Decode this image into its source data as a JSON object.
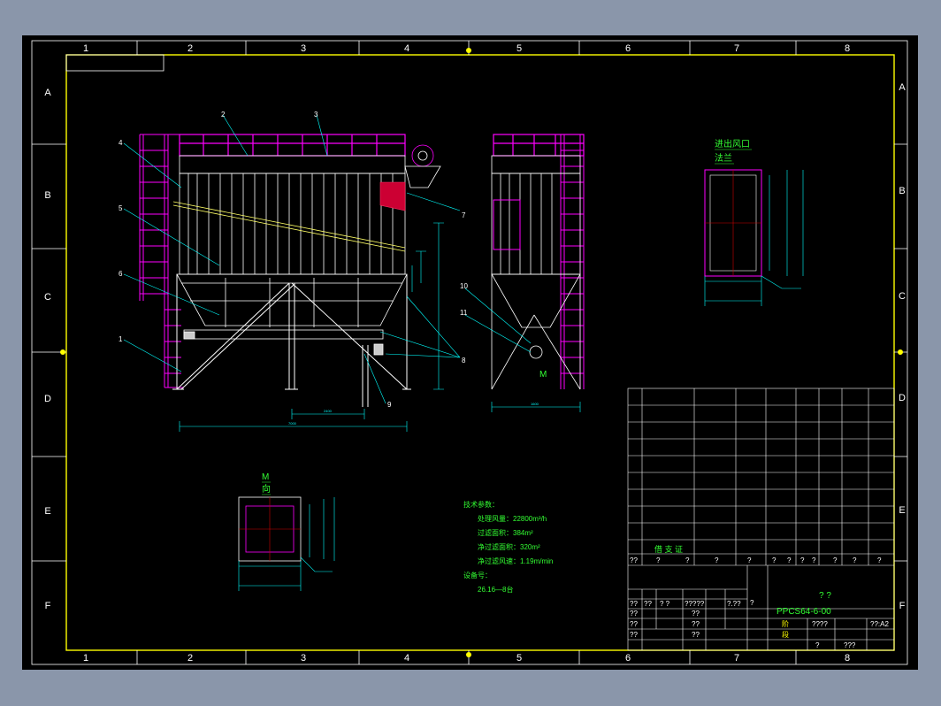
{
  "zones": {
    "columns": [
      "1",
      "2",
      "3",
      "4",
      "5",
      "6",
      "7",
      "8"
    ],
    "rows": [
      "A",
      "B",
      "C",
      "D",
      "E",
      "F"
    ]
  },
  "callouts_main": [
    "1",
    "2",
    "3",
    "4",
    "5",
    "6",
    "7",
    "8",
    "9",
    "10"
  ],
  "callouts_side": [
    "10",
    "11"
  ],
  "view_marker_label": "M",
  "view_m": {
    "title": "M",
    "subtitle": "向"
  },
  "flange": {
    "title": "进出风口",
    "subtitle": "法兰"
  },
  "tech_params": {
    "heading": "技术参数：",
    "lines": [
      "处理风量：22800m³/h",
      "过滤面积：384m²",
      "净过滤面积：320m²",
      "净过滤风速：1.19m/min"
    ],
    "equip_heading": "设备号：",
    "equip_line": "26.16—8台"
  },
  "title_block": {
    "signature_label": "借 支 证",
    "question_row": [
      "??",
      "?",
      "?",
      "?",
      "?",
      "?",
      "?",
      "?",
      "?",
      "?",
      "?",
      "?"
    ],
    "drawing_name": "?  ?",
    "drawing_number": "PPCS64-6-00",
    "sheet_size": "??:A2",
    "scale_label": "????",
    "stage_labels": [
      "阶",
      "段"
    ],
    "bottom_marks": [
      "?",
      "???",
      "?"
    ],
    "left_cells": [
      "??",
      "??",
      "?  ?",
      "?????",
      "?.??",
      "??",
      "??",
      "??",
      "??",
      "??",
      "??"
    ]
  },
  "colors": {
    "frame": "#ffff00",
    "structure": "#ff00ff",
    "dimension": "#00ffff",
    "text": "#33ff33",
    "background": "#000000"
  }
}
